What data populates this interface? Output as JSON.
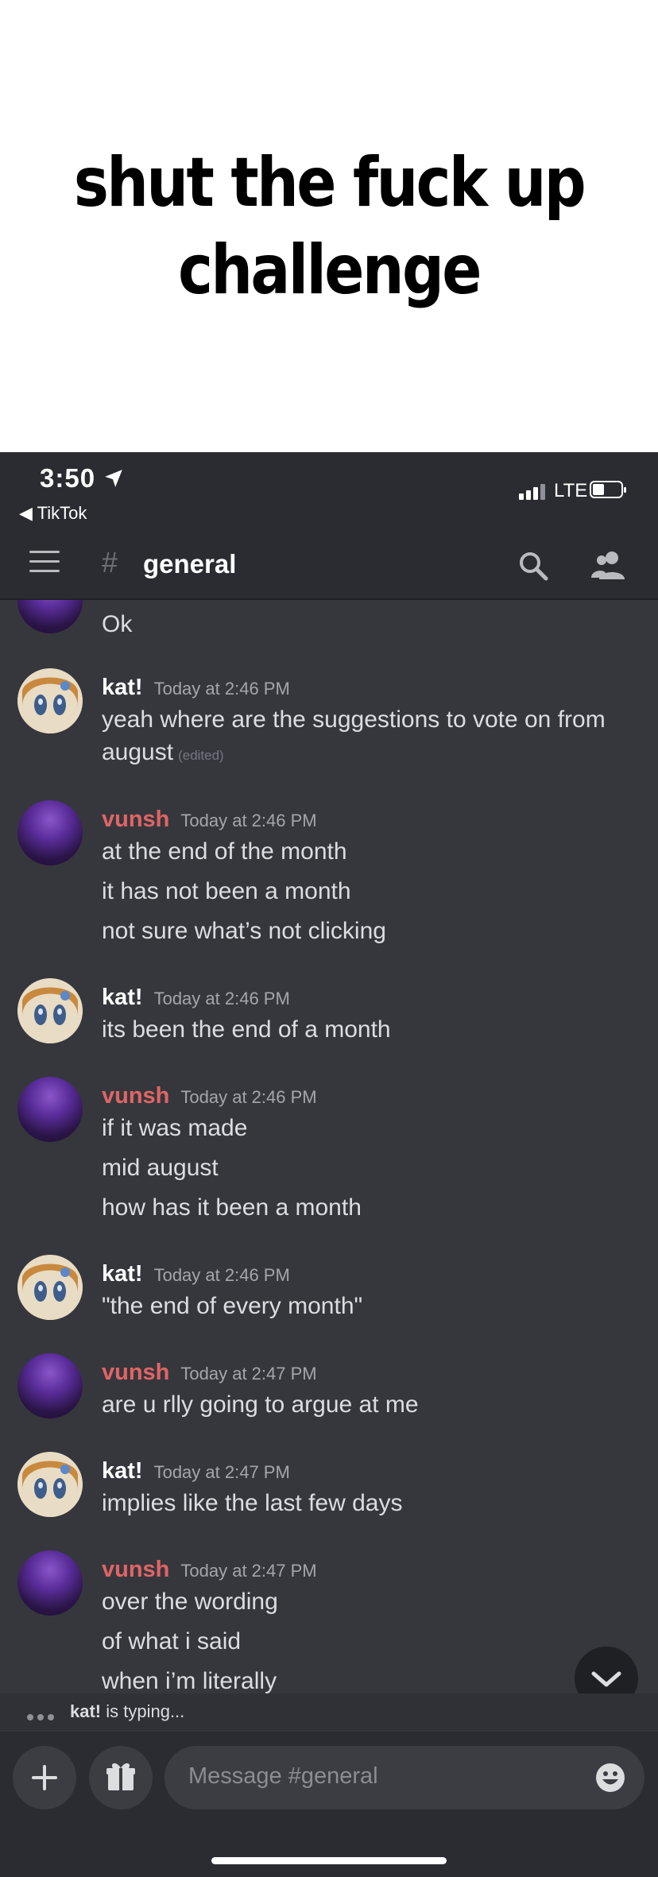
{
  "caption": {
    "line1": "shut the fuck up",
    "line2": "challenge"
  },
  "status_bar": {
    "time": "3:50",
    "back_app": "◀ TikTok",
    "network": "LTE"
  },
  "nav": {
    "channel_symbol": "#",
    "channel_name": "general"
  },
  "messages": [
    {
      "author": "",
      "time": "",
      "lines": [
        "Ok"
      ],
      "avatar": "vunsh"
    },
    {
      "author": "kat!",
      "time": "Today at 2:46 PM",
      "lines": [
        "yeah where are the suggestions to vote on from",
        "august"
      ],
      "edited": "(edited)",
      "avatar": "kat"
    },
    {
      "author": "vunsh",
      "time": "Today at 2:46 PM",
      "lines": [
        "at the end of the month",
        "it has not been a month",
        "not sure what’s not clicking"
      ],
      "avatar": "vunsh"
    },
    {
      "author": "kat!",
      "time": "Today at 2:46 PM",
      "lines": [
        "its been the end of a month"
      ],
      "avatar": "kat"
    },
    {
      "author": "vunsh",
      "time": "Today at 2:46 PM",
      "lines": [
        "if it was made",
        "mid august",
        "how has it been a month"
      ],
      "avatar": "vunsh"
    },
    {
      "author": "kat!",
      "time": "Today at 2:46 PM",
      "lines": [
        "\"the end of every month\""
      ],
      "avatar": "kat"
    },
    {
      "author": "vunsh",
      "time": "Today at 2:47 PM",
      "lines": [
        "are u rlly going to argue at me"
      ],
      "avatar": "vunsh"
    },
    {
      "author": "kat!",
      "time": "Today at 2:47 PM",
      "lines": [
        "implies like the last few days"
      ],
      "avatar": "kat"
    },
    {
      "author": "vunsh",
      "time": "Today at 2:47 PM",
      "lines": [
        "over the wording",
        "of what i said",
        "when i’m literally"
      ],
      "avatar": "vunsh"
    }
  ],
  "typing": {
    "user": "kat!",
    "suffix": " is typing..."
  },
  "composer": {
    "placeholder": "Message #general"
  },
  "colors": {
    "background": "#36373d",
    "bar": "#2b2c31",
    "vunsh_name": "#e06565",
    "kat_name": "#ffffff"
  }
}
